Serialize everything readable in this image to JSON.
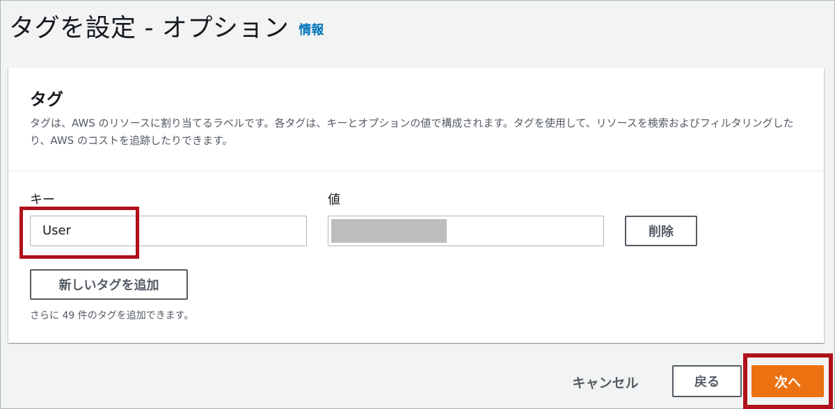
{
  "header": {
    "title": "タグを設定 - オプション",
    "info_link": "情報"
  },
  "tags_panel": {
    "title": "タグ",
    "description": "タグは、AWS のリソースに割り当てるラベルです。各タグは、キーとオプションの値で構成されます。タグを使用して、リソースを検索およびフィルタリングしたり、AWS のコストを追跡したりできます。",
    "key_label": "キー",
    "value_label": "値",
    "key_value": "User",
    "remove_label": "削除",
    "add_tag_label": "新しいタグを追加",
    "remaining_text": "さらに 49 件のタグを追加できます。"
  },
  "footer": {
    "cancel_label": "キャンセル",
    "back_label": "戻る",
    "next_label": "次へ"
  },
  "colors": {
    "primary_button": "#ec7211",
    "link": "#0073bb",
    "highlight_box": "#b0111a"
  }
}
